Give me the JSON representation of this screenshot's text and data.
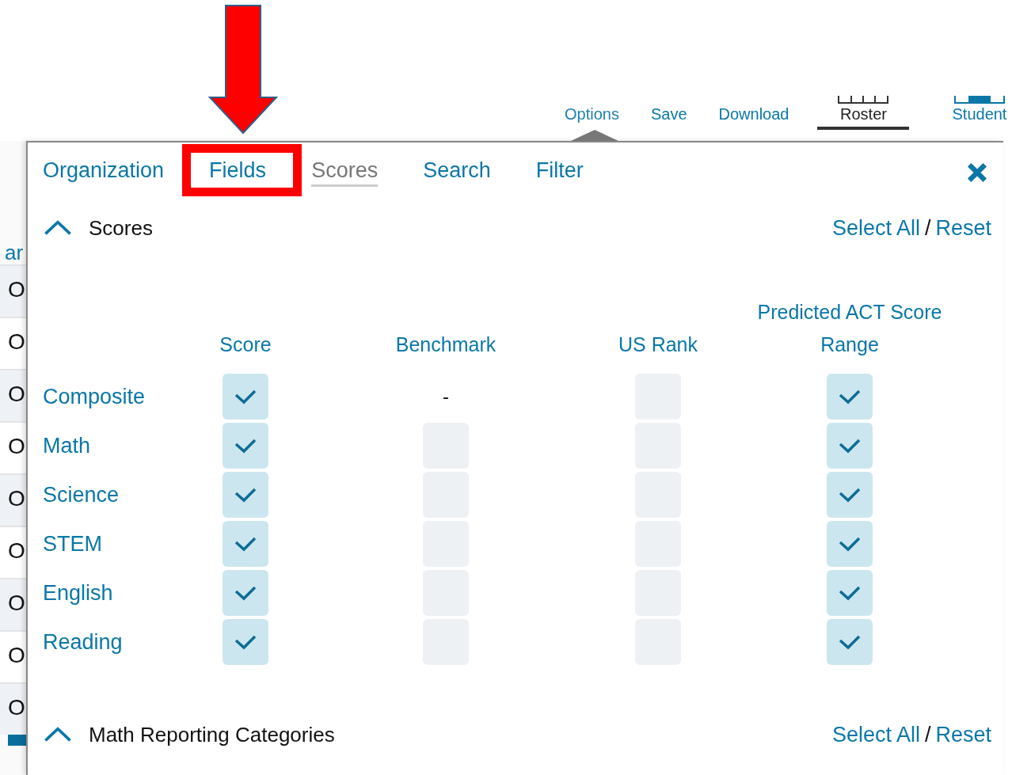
{
  "toolbar": {
    "items": [
      {
        "label": "Options",
        "kind": "link",
        "selected": true
      },
      {
        "label": "Save",
        "kind": "link",
        "selected": false
      },
      {
        "label": "Download",
        "kind": "link",
        "selected": false
      },
      {
        "label": "Roster",
        "kind": "view",
        "selected": true
      },
      {
        "label": "Student",
        "kind": "view",
        "selected": false
      }
    ]
  },
  "background_list": {
    "heading": "ar",
    "rows": [
      "O",
      "O",
      "O",
      "O",
      "O",
      "O",
      "O",
      "O",
      "O"
    ]
  },
  "panel": {
    "tabs": [
      {
        "label": "Organization",
        "selected": false
      },
      {
        "label": "Fields",
        "selected": false,
        "highlighted": true
      },
      {
        "label": "Scores",
        "selected": true
      },
      {
        "label": "Search",
        "selected": false
      },
      {
        "label": "Filter",
        "selected": false
      }
    ],
    "sections": [
      {
        "title": "Scores",
        "expanded": true,
        "select_all": "Select All",
        "separator": "/",
        "reset": "Reset",
        "columns": [
          "Score",
          "Benchmark",
          "US Rank",
          "Predicted ACT Score Range"
        ],
        "rows": [
          {
            "label": "Composite",
            "cells": [
              {
                "kind": "check",
                "checked": true
              },
              {
                "kind": "text",
                "text": "-"
              },
              {
                "kind": "check",
                "checked": false
              },
              {
                "kind": "check",
                "checked": true
              }
            ]
          },
          {
            "label": "Math",
            "cells": [
              {
                "kind": "check",
                "checked": true
              },
              {
                "kind": "check",
                "checked": false
              },
              {
                "kind": "check",
                "checked": false
              },
              {
                "kind": "check",
                "checked": true
              }
            ]
          },
          {
            "label": "Science",
            "cells": [
              {
                "kind": "check",
                "checked": true
              },
              {
                "kind": "check",
                "checked": false
              },
              {
                "kind": "check",
                "checked": false
              },
              {
                "kind": "check",
                "checked": true
              }
            ]
          },
          {
            "label": "STEM",
            "cells": [
              {
                "kind": "check",
                "checked": true
              },
              {
                "kind": "check",
                "checked": false
              },
              {
                "kind": "check",
                "checked": false
              },
              {
                "kind": "check",
                "checked": true
              }
            ]
          },
          {
            "label": "English",
            "cells": [
              {
                "kind": "check",
                "checked": true
              },
              {
                "kind": "check",
                "checked": false
              },
              {
                "kind": "check",
                "checked": false
              },
              {
                "kind": "check",
                "checked": true
              }
            ]
          },
          {
            "label": "Reading",
            "cells": [
              {
                "kind": "check",
                "checked": true
              },
              {
                "kind": "check",
                "checked": false
              },
              {
                "kind": "check",
                "checked": false
              },
              {
                "kind": "check",
                "checked": true
              }
            ]
          }
        ]
      },
      {
        "title": "Math Reporting Categories",
        "expanded": true,
        "select_all": "Select All",
        "separator": "/",
        "reset": "Reset"
      }
    ]
  }
}
